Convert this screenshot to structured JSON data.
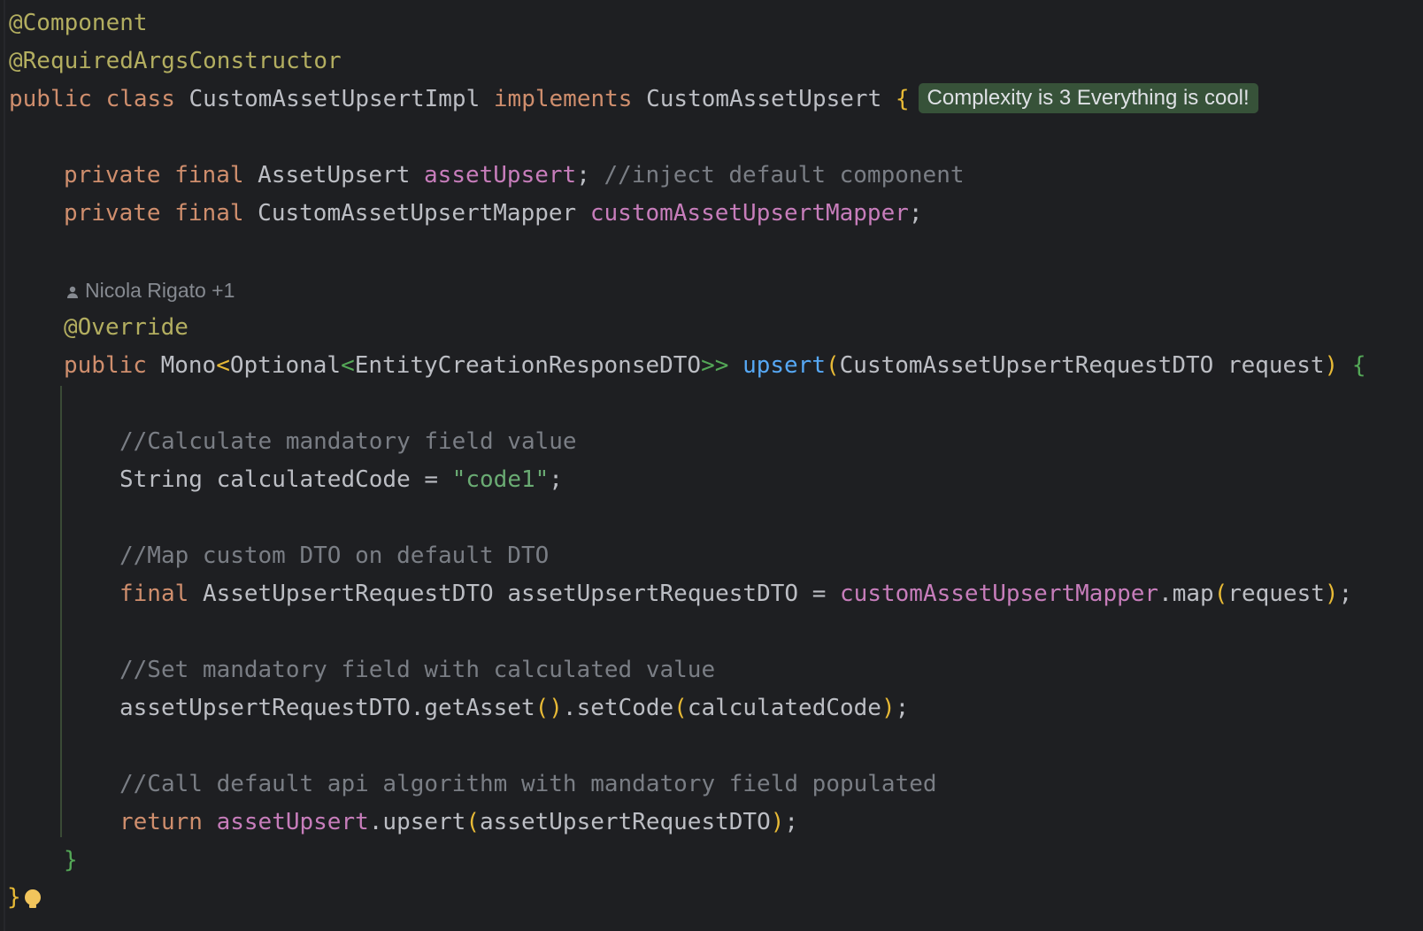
{
  "lines": {
    "l1": {
      "annotation": "@Component"
    },
    "l2": {
      "annotation": "@RequiredArgsConstructor"
    },
    "l3": {
      "kw_public": "public",
      "kw_class": "class",
      "class_name": "CustomAssetUpsertImpl",
      "kw_implements": "implements",
      "interface_name": "CustomAssetUpsert",
      "brace": "{",
      "badge": "Complexity is 3 Everything is cool!"
    },
    "l4": {
      "kw_private": "private",
      "kw_final": "final",
      "type": "AssetUpsert",
      "field": "assetUpsert",
      "semi": ";",
      "comment": "//inject default component"
    },
    "l5": {
      "kw_private": "private",
      "kw_final": "final",
      "type": "CustomAssetUpsertMapper",
      "field": "customAssetUpsertMapper",
      "semi": ";"
    },
    "author": "Nicola Rigato +1",
    "l6": {
      "annotation": "@Override"
    },
    "l7": {
      "kw_public": "public",
      "type_a": "Mono",
      "lt1": "<",
      "type_b": "Optional",
      "lt2": "<",
      "type_c": "EntityCreationResponseDTO",
      "gt": ">>",
      "method": "upsert",
      "paren_open": "(",
      "param_type": "CustomAssetUpsertRequestDTO",
      "param_name": "request",
      "paren_close": ")",
      "brace": "{"
    },
    "l8": {
      "comment": "//Calculate mandatory field value"
    },
    "l9": {
      "type": "String",
      "var": "calculatedCode",
      "eq": "=",
      "string": "\"code1\"",
      "semi": ";"
    },
    "l10": {
      "comment": "//Map custom DTO on default DTO"
    },
    "l11": {
      "kw_final": "final",
      "type": "AssetUpsertRequestDTO",
      "var": "assetUpsertRequestDTO",
      "eq": "=",
      "field": "customAssetUpsertMapper",
      "call": ".map",
      "paren_open": "(",
      "arg": "request",
      "paren_close": ")",
      "semi": ";"
    },
    "l12": {
      "comment": "//Set mandatory field with calculated value"
    },
    "l13": {
      "target": "assetUpsertRequestDTO.getAsset",
      "parens": "()",
      "call": ".setCode",
      "paren_open": "(",
      "arg": "calculatedCode",
      "paren_close": ")",
      "semi": ";"
    },
    "l14": {
      "comment": "//Call default api algorithm with mandatory field populated"
    },
    "l15": {
      "kw_return": "return",
      "field": "assetUpsert",
      "call": ".upsert",
      "paren_open": "(",
      "arg": "assetUpsertRequestDTO",
      "paren_close": ")",
      "semi": ";"
    },
    "l16": {
      "brace": "}"
    },
    "l17": {
      "brace": "}"
    }
  },
  "icons": {
    "author": "person-icon",
    "intention": "lightbulb-icon"
  },
  "colors": {
    "background": "#1e1f22",
    "keyword": "#cf8e6d",
    "annotation": "#b3ae60",
    "field": "#c77dbb",
    "method": "#56a8f5",
    "string": "#6aab73",
    "comment": "#7a7e85",
    "badge_bg": "#375239"
  }
}
